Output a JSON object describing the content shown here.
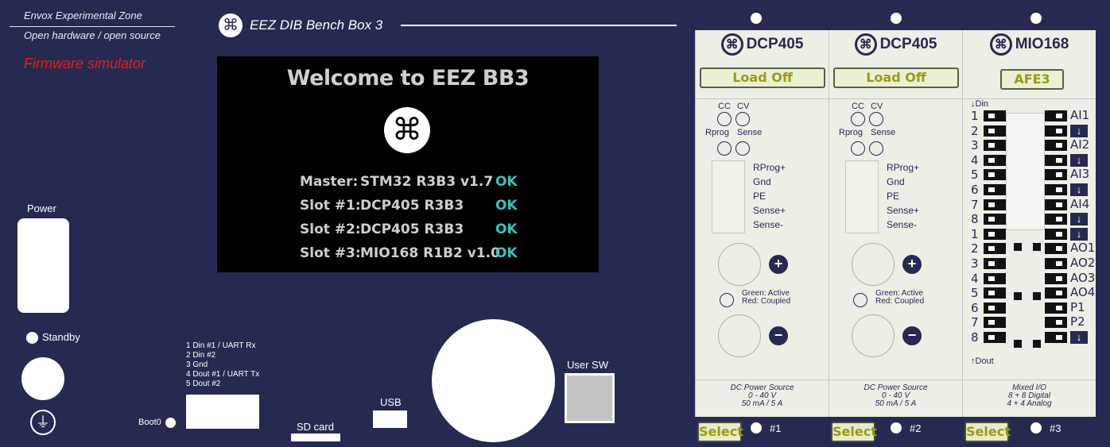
{
  "brand": {
    "line1": "Envox Experimental Zone",
    "line2": "Open hardware / open source",
    "simulator": "Firmware simulator"
  },
  "title": "EEZ DIB Bench Box 3",
  "display": {
    "welcome": "Welcome to EEZ BB3",
    "rows": [
      {
        "label": "Master:",
        "value": "STM32 R3B3 v1.7",
        "status": "OK"
      },
      {
        "label": "Slot #1:",
        "value": "DCP405 R3B3",
        "status": "OK"
      },
      {
        "label": "Slot #2:",
        "value": "DCP405 R3B3",
        "status": "OK"
      },
      {
        "label": "Slot #3:",
        "value": "MIO168 R1B2 v1.0",
        "status": "OK"
      }
    ]
  },
  "controls": {
    "power": "Power",
    "standby": "Standby",
    "boot0": "Boot0",
    "pins": [
      "1 Din #1 / UART Rx",
      "2 Din #2",
      "3 Gnd",
      "4 Dout #1 / UART Tx",
      "5 Dout #2"
    ],
    "sd_card": "SD card",
    "usb": "USB",
    "user_sw": "User SW",
    "ground_icon": "ground-symbol"
  },
  "modules": [
    {
      "name": "DCP405",
      "status": "Load Off",
      "cc": "CC",
      "cv": "CV",
      "rprog": "Rprog",
      "sense": "Sense",
      "terminals": [
        "RProg+",
        "Gnd",
        "PE",
        "Sense+",
        "Sense-"
      ],
      "led_legend1": "Green: Active",
      "led_legend2": "Red: Coupled",
      "footer": [
        "DC Power Source",
        "0 - 40 V",
        "50 mA / 5 A"
      ],
      "select": "Select",
      "slot": "#1"
    },
    {
      "name": "DCP405",
      "status": "Load Off",
      "cc": "CC",
      "cv": "CV",
      "rprog": "Rprog",
      "sense": "Sense",
      "terminals": [
        "RProg+",
        "Gnd",
        "PE",
        "Sense+",
        "Sense-"
      ],
      "led_legend1": "Green: Active",
      "led_legend2": "Red: Coupled",
      "footer": [
        "DC Power Source",
        "0 - 40 V",
        "50 mA / 5 A"
      ],
      "select": "Select",
      "slot": "#2"
    },
    {
      "name": "MIO168",
      "status": "AFE3",
      "din": "Din",
      "dout": "Dout",
      "din_numbers": [
        "1",
        "2",
        "3",
        "4",
        "5",
        "6",
        "7",
        "8"
      ],
      "dout_numbers": [
        "1",
        "2",
        "3",
        "4",
        "5",
        "6",
        "7",
        "8"
      ],
      "right_labels": [
        "AI1",
        "",
        "AI2",
        "",
        "AI3",
        "",
        "AI4",
        "",
        "",
        "AO1",
        "AO2",
        "AO3",
        "AO4",
        "P1",
        "P2",
        ""
      ],
      "footer": [
        "Mixed I/O",
        "8 + 8 Digital",
        "4 + 4 Analog"
      ],
      "select": "Select",
      "slot": "#3"
    }
  ],
  "colors": {
    "background": "#262a51",
    "module": "#ecefe6",
    "status_text": "#9a9a1a",
    "ok": "#3cc0b8",
    "simulator": "#e0201c"
  }
}
